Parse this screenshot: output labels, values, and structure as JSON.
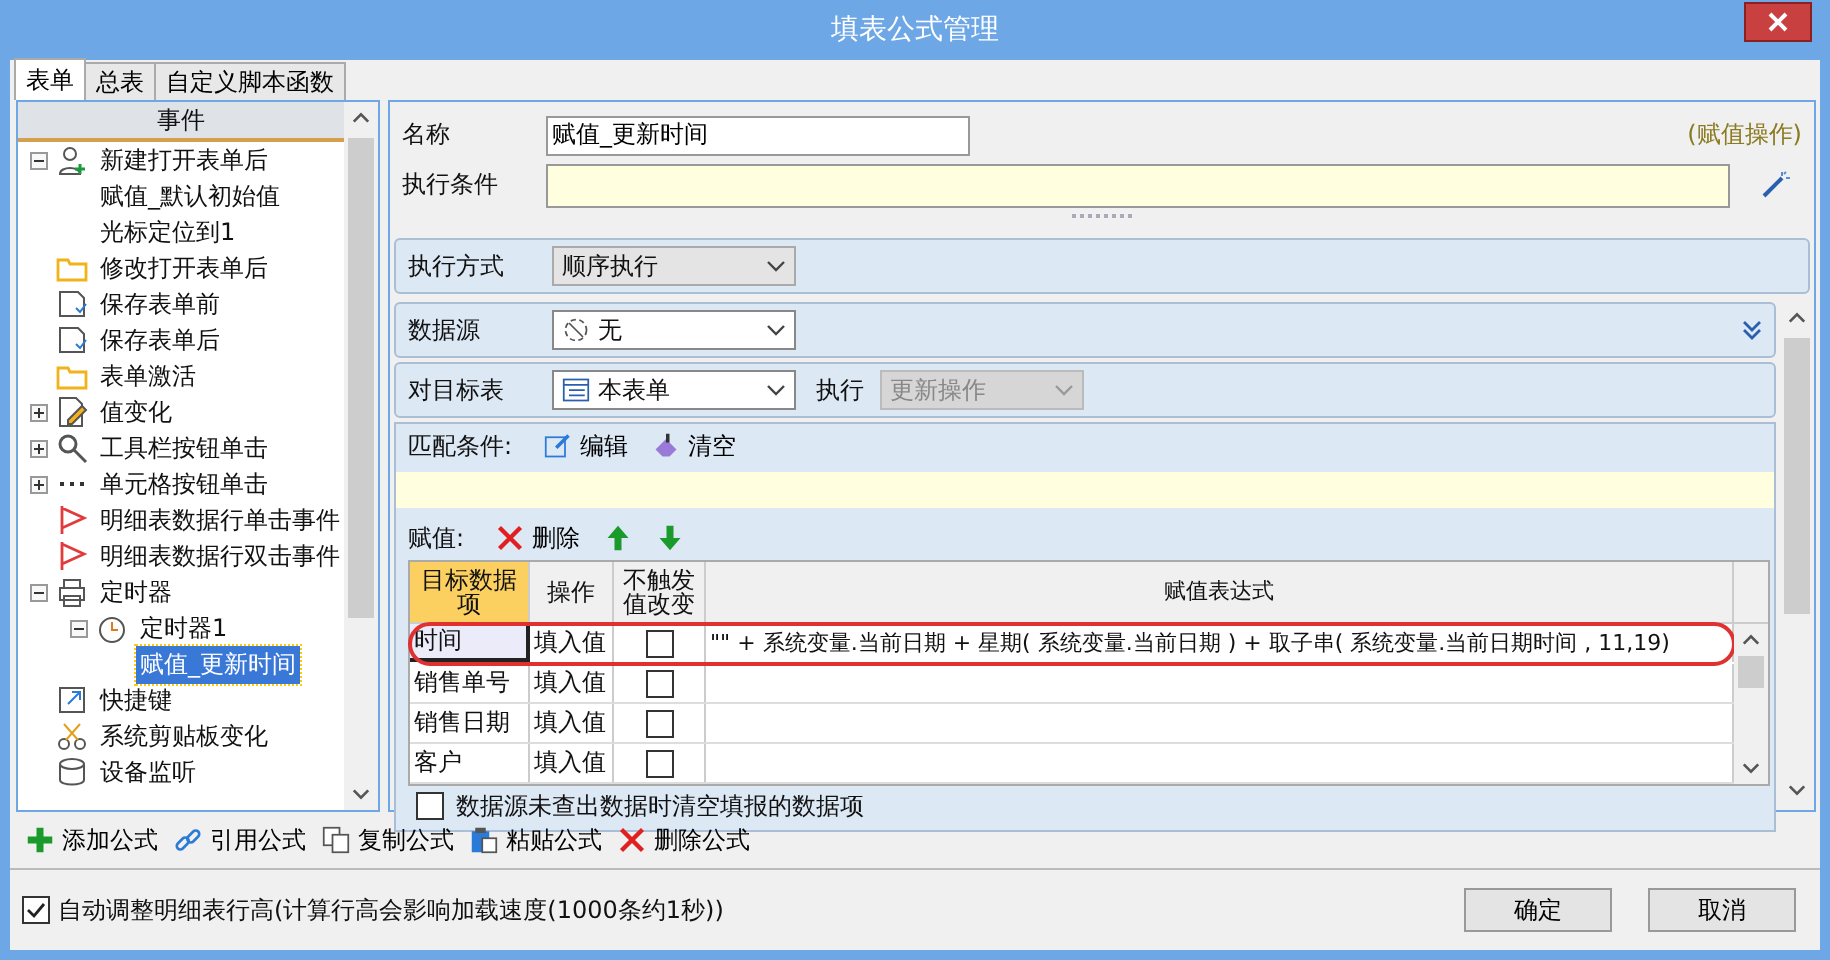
{
  "window": {
    "title": "填表公式管理"
  },
  "tabs": [
    {
      "label": "表单",
      "selected": true
    },
    {
      "label": "总表",
      "selected": false
    },
    {
      "label": "自定义脚本函数",
      "selected": false
    }
  ],
  "event_tree": {
    "header": "事件",
    "items": [
      {
        "label": "新建打开表单后",
        "kind": "person",
        "expanded": true,
        "selected": false,
        "children": [
          {
            "label": "赋值_默认初始值",
            "selected": false
          },
          {
            "label": "光标定位到1",
            "selected": false
          }
        ]
      },
      {
        "label": "修改打开表单后",
        "kind": "folder",
        "selected": false
      },
      {
        "label": "保存表单前",
        "kind": "save",
        "selected": false
      },
      {
        "label": "保存表单后",
        "kind": "save",
        "selected": false
      },
      {
        "label": "表单激活",
        "kind": "folder",
        "selected": false
      },
      {
        "label": "值变化",
        "kind": "edit",
        "expanded": false,
        "selected": false
      },
      {
        "label": "工具栏按钮单击",
        "kind": "search",
        "expanded": false,
        "selected": false
      },
      {
        "label": "单元格按钮单击",
        "kind": "dots",
        "expanded": false,
        "selected": false
      },
      {
        "label": "明细表数据行单击事件",
        "kind": "flag",
        "selected": false
      },
      {
        "label": "明细表数据行双击事件",
        "kind": "flag",
        "selected": false
      },
      {
        "label": "定时器",
        "kind": "timer",
        "expanded": true,
        "selected": false,
        "children": [
          {
            "label": "定时器1",
            "kind": "clock",
            "expanded": true,
            "selected": false,
            "children": [
              {
                "label": "赋值_更新时间",
                "selected": true
              }
            ]
          }
        ]
      },
      {
        "label": "快捷键",
        "kind": "shortcut",
        "selected": false
      },
      {
        "label": "系统剪贴板变化",
        "kind": "scissors",
        "selected": false
      },
      {
        "label": "设备监听",
        "kind": "device",
        "selected": false
      }
    ]
  },
  "name_field": {
    "label": "名称",
    "value": "赋值_更新时间"
  },
  "operation_note": "(赋值操作)",
  "condition_field": {
    "label": "执行条件"
  },
  "exec_mode": {
    "label": "执行方式",
    "value": "顺序执行"
  },
  "data_source": {
    "label": "数据源",
    "value": "无"
  },
  "target": {
    "label": "对目标表",
    "value": "本表单",
    "exec_label": "执行",
    "exec_value": "更新操作",
    "exec_disabled": true
  },
  "match": {
    "label": "匹配条件:",
    "buttons": [
      {
        "label": "编辑",
        "kind": "edit"
      },
      {
        "label": "清空",
        "kind": "clear"
      }
    ]
  },
  "assign": {
    "label": "赋值:",
    "buttons": [
      {
        "label": "删除",
        "kind": "delete"
      },
      {
        "kind": "up"
      },
      {
        "kind": "down"
      }
    ]
  },
  "grid": {
    "columns": [
      "目标数据项",
      "操作",
      "不触发值改变",
      "赋值表达式"
    ],
    "rows": [
      {
        "target": "时间",
        "op": "填入值",
        "checked": false,
        "expr": "\"\" + 系统变量.当前日期  + 星期( 系统变量.当前日期 ) + 取子串( 系统变量.当前日期时间 , 11,19)",
        "selected": true
      },
      {
        "target": "销售单号",
        "op": "填入值",
        "checked": false,
        "selected": false
      },
      {
        "target": "销售日期",
        "op": "填入值",
        "checked": false,
        "selected": false
      },
      {
        "target": "客户",
        "op": "填入值",
        "checked": false,
        "selected": false
      }
    ]
  },
  "clear_option": {
    "label": "数据源未查出数据时清空填报的数据项",
    "checked": false
  },
  "toolbar": [
    {
      "label": "添加公式",
      "kind": "add"
    },
    {
      "label": "引用公式",
      "kind": "link"
    },
    {
      "label": "复制公式",
      "kind": "copy"
    },
    {
      "label": "粘贴公式",
      "kind": "paste"
    },
    {
      "label": "删除公式",
      "kind": "delete"
    }
  ],
  "auto_height": {
    "label": "自动调整明细表行高(计算行高会影响加载速度(1000条约1秒))",
    "checked": true
  },
  "buttons": [
    "确定",
    "取消"
  ]
}
